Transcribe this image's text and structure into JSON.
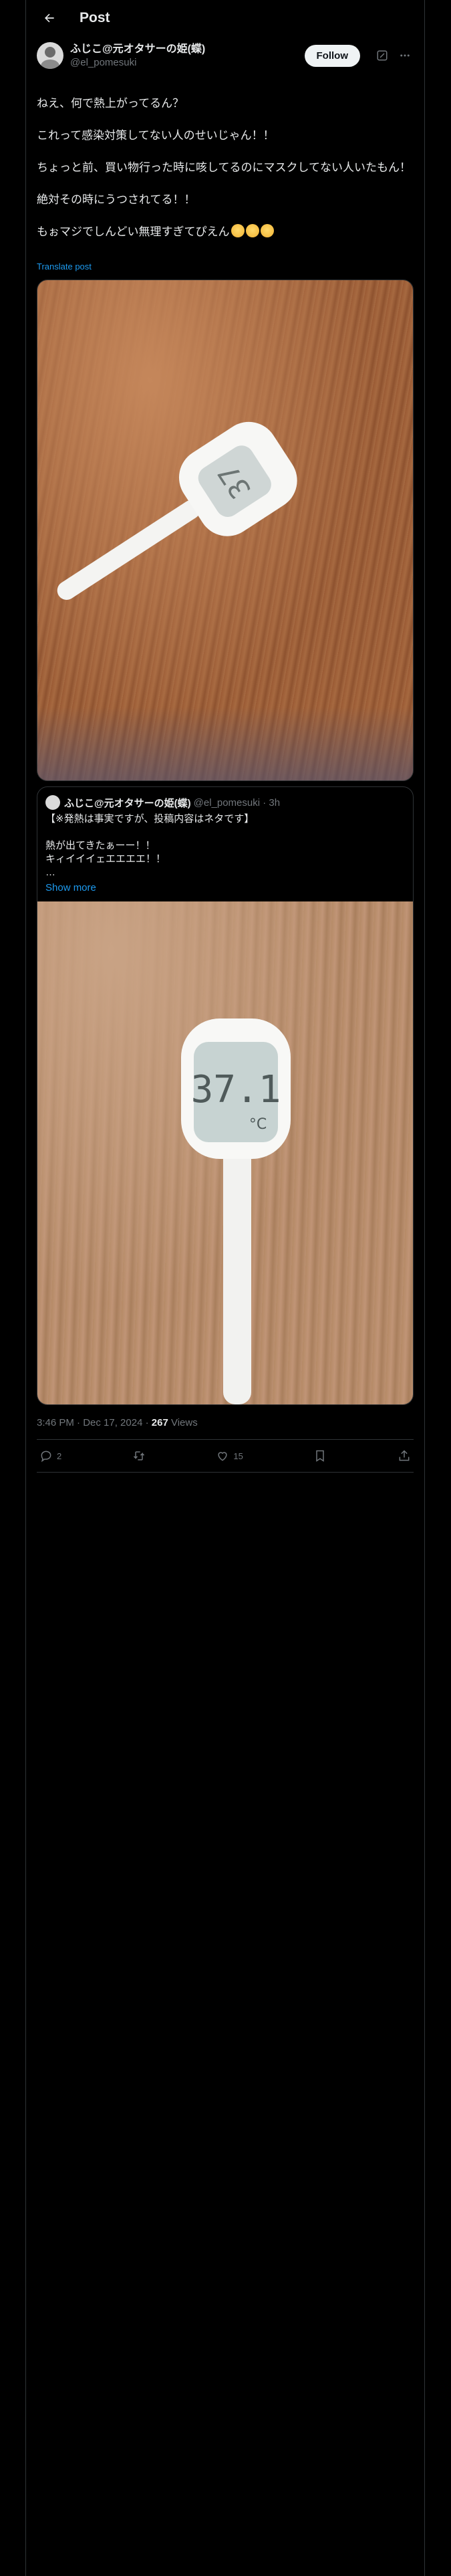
{
  "header": {
    "title": "Post",
    "back_icon": "arrow-left-icon"
  },
  "post": {
    "author_name": "ふじこ@元オタサーの姫(蝶)",
    "author_handle": "@el_pomesuki",
    "follow_label": "Follow",
    "lines": [
      "ねえ、何で熱上がってるん？",
      "これって感染対策してない人のせいじゃん！！",
      "ちょっと前、買い物行った時に咳してるのにマスクしてない人いたもん！",
      "絶対その時にうつされてる！！"
    ],
    "last_line": "もぉマジでしんどい無理すぎてぴえん",
    "emoji_count": 3,
    "translate_label": "Translate post"
  },
  "quote": {
    "author_name": "ふじこ@元オタサーの姫(蝶)",
    "author_handle": "@el_pomesuki · 3h",
    "line1": "【※発熱は事実ですが、投稿内容はネタです】",
    "line2": "熱が出てきたぁーー！！",
    "line3": "キィイイイェエエエエ！！",
    "line4": "…",
    "show_more": "Show more"
  },
  "meta": {
    "timestamp": "3:46 PM · Dec 17, 2024 · ",
    "views_count": "267",
    "views_label": " Views"
  },
  "actions": {
    "reply_count": "2",
    "like_count": "15"
  },
  "thermometer_reading": "37.1"
}
